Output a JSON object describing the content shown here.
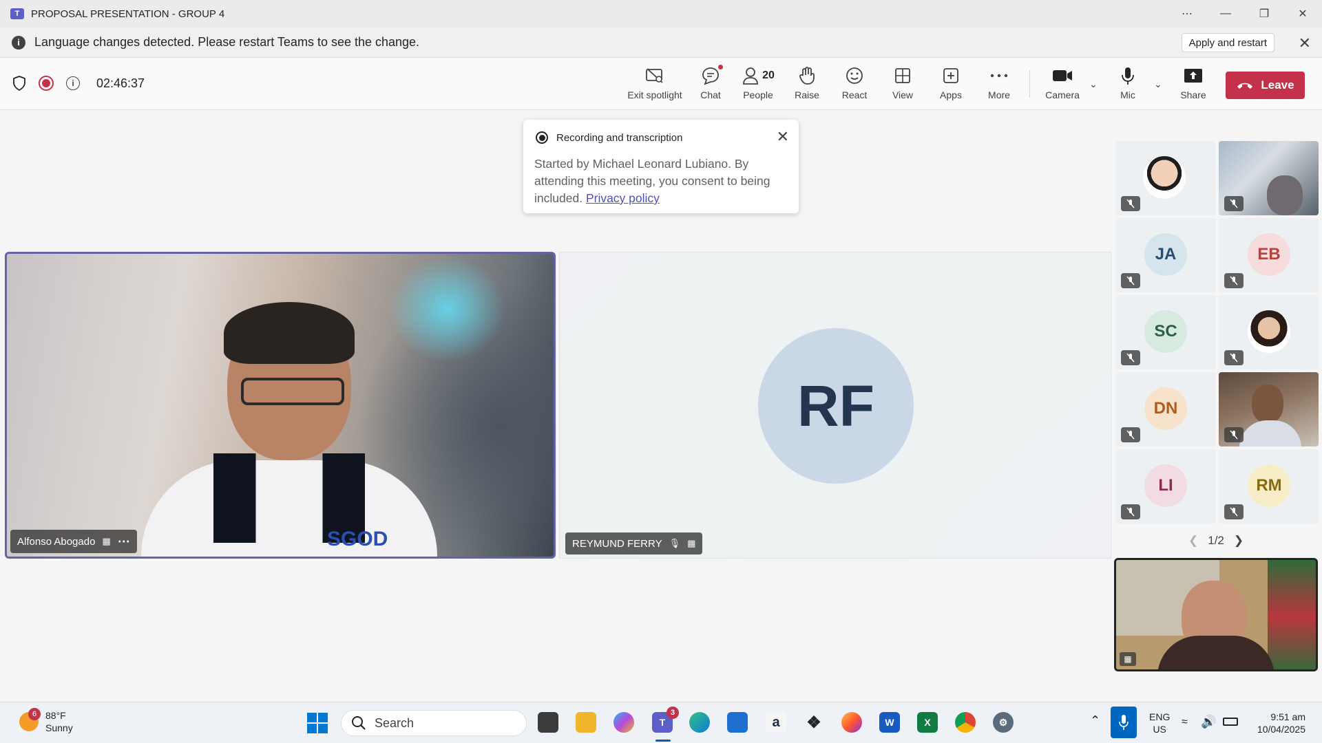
{
  "window": {
    "title": "PROPOSAL PRESENTATION - GROUP 4",
    "controls": [
      "more-options",
      "minimize",
      "restore",
      "close"
    ]
  },
  "banner": {
    "message": "Language changes detected. Please restart Teams to see the change.",
    "action": "Apply and restart"
  },
  "toolbar": {
    "timer": "02:46:37",
    "items": {
      "exit_spotlight": "Exit spotlight",
      "chat": "Chat",
      "people": "People",
      "people_count": "20",
      "raise": "Raise",
      "react": "React",
      "view": "View",
      "apps": "Apps",
      "more": "More",
      "camera": "Camera",
      "mic": "Mic",
      "share": "Share"
    },
    "leave": "Leave"
  },
  "toast": {
    "title": "Recording and transcription",
    "body": "Started by Michael Leonard Lubiano. By attending this meeting, you consent to being included.",
    "link": "Privacy policy"
  },
  "stage": {
    "spotlight_name": "Alfonso Abogado",
    "second_name": "REYMUND FERRY",
    "second_initials": "RF"
  },
  "gallery": {
    "tiles": [
      {
        "initials": "",
        "kind": "photo"
      },
      {
        "initials": "",
        "kind": "video"
      },
      {
        "initials": "JA",
        "color": "#2b4c6f",
        "bg": "#d6e4ee"
      },
      {
        "initials": "EB",
        "color": "#b2453d",
        "bg": "#f6dcdc"
      },
      {
        "initials": "SC",
        "color": "#2b5e4a",
        "bg": "#d7eae0"
      },
      {
        "initials": "",
        "kind": "photo"
      },
      {
        "initials": "DN",
        "color": "#b05b1c",
        "bg": "#f7e2cc"
      },
      {
        "initials": "",
        "kind": "video"
      },
      {
        "initials": "LI",
        "color": "#8e2b4a",
        "bg": "#f2dbe3"
      },
      {
        "initials": "RM",
        "color": "#8a6a10",
        "bg": "#f7edc6"
      }
    ],
    "page": "1/2"
  },
  "taskbar": {
    "weather_badge": "6",
    "temperature": "88°F",
    "condition": "Sunny",
    "search": "Search",
    "teams_badge": "3",
    "lang_primary": "ENG",
    "lang_region": "US",
    "time": "9:51 am",
    "date": "10/04/2025"
  },
  "colors": {
    "accent": "#6264a7",
    "leave": "#c4314b",
    "taskbar_mic": "#0067c0"
  }
}
